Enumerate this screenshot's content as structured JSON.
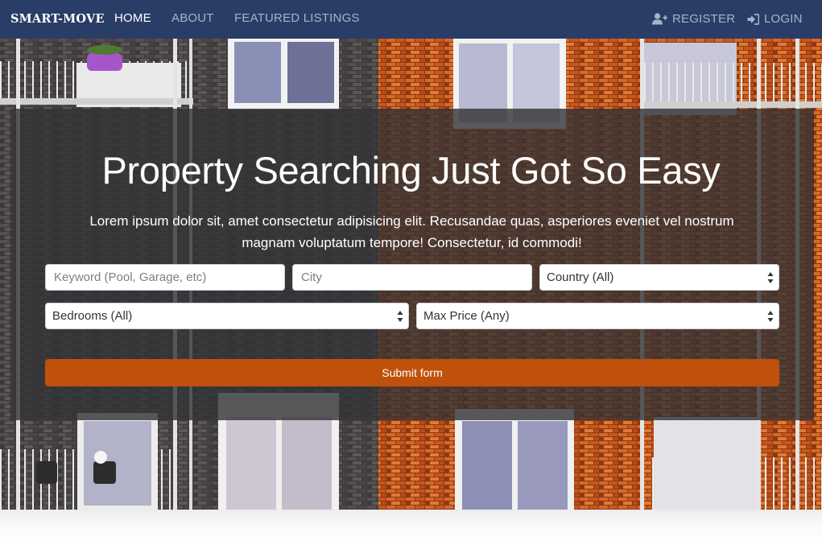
{
  "navbar": {
    "brand": "SMART-MOVE",
    "links": [
      {
        "label": "HOME",
        "active": true
      },
      {
        "label": "ABOUT",
        "active": false
      },
      {
        "label": "FEATURED LISTINGS",
        "active": false
      }
    ],
    "register_label": "REGISTER",
    "register_icon": "user-plus-icon",
    "login_label": "LOGIN",
    "login_icon": "sign-in-icon"
  },
  "hero": {
    "title": "Property Searching Just Got So Easy",
    "text": "Lorem ipsum dolor sit, amet consectetur adipisicing elit. Recusandae quas, asperiores eveniet vel nostrum magnam voluptatum tempore! Consectetur, id commodi!"
  },
  "search_form": {
    "keyword_placeholder": "Keyword (Pool, Garage, etc)",
    "city_placeholder": "City",
    "country_selected": "Country (All)",
    "bedrooms_selected": "Bedrooms (All)",
    "max_price_selected": "Max Price (Any)",
    "submit_label": "Submit form"
  },
  "colors": {
    "navbar": "#2a3d67",
    "submit": "#c0510a",
    "overlay": "rgba(50,50,52,0.8)"
  }
}
